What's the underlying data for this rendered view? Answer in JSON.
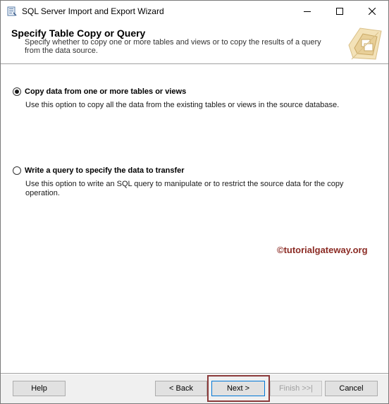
{
  "window": {
    "title": "SQL Server Import and Export Wizard",
    "icons": {
      "app": "wizard-icon",
      "minimize": "minimize-icon",
      "maximize": "maximize-icon",
      "close": "close-icon"
    }
  },
  "header": {
    "title": "Specify Table Copy or Query",
    "description": "Specify whether to copy one or more tables and views or to copy the results of a query from the data source.",
    "graphic": "wizard-graphic-icon"
  },
  "options": [
    {
      "label": "Copy data from one or more tables or views",
      "description": "Use this option to copy all the data from the existing tables or views in the source database.",
      "selected": true
    },
    {
      "label": "Write a query to specify the data to transfer",
      "description": "Use this option to write an SQL query to manipulate or to restrict the source data for the copy operation.",
      "selected": false
    }
  ],
  "watermark": "©tutorialgateway.org",
  "footer": {
    "help": "Help",
    "back": "< Back",
    "next": "Next >",
    "finish": "Finish >>|",
    "cancel": "Cancel"
  },
  "colors": {
    "watermark": "#8b2b24",
    "highlight": "#8b3a3a"
  }
}
